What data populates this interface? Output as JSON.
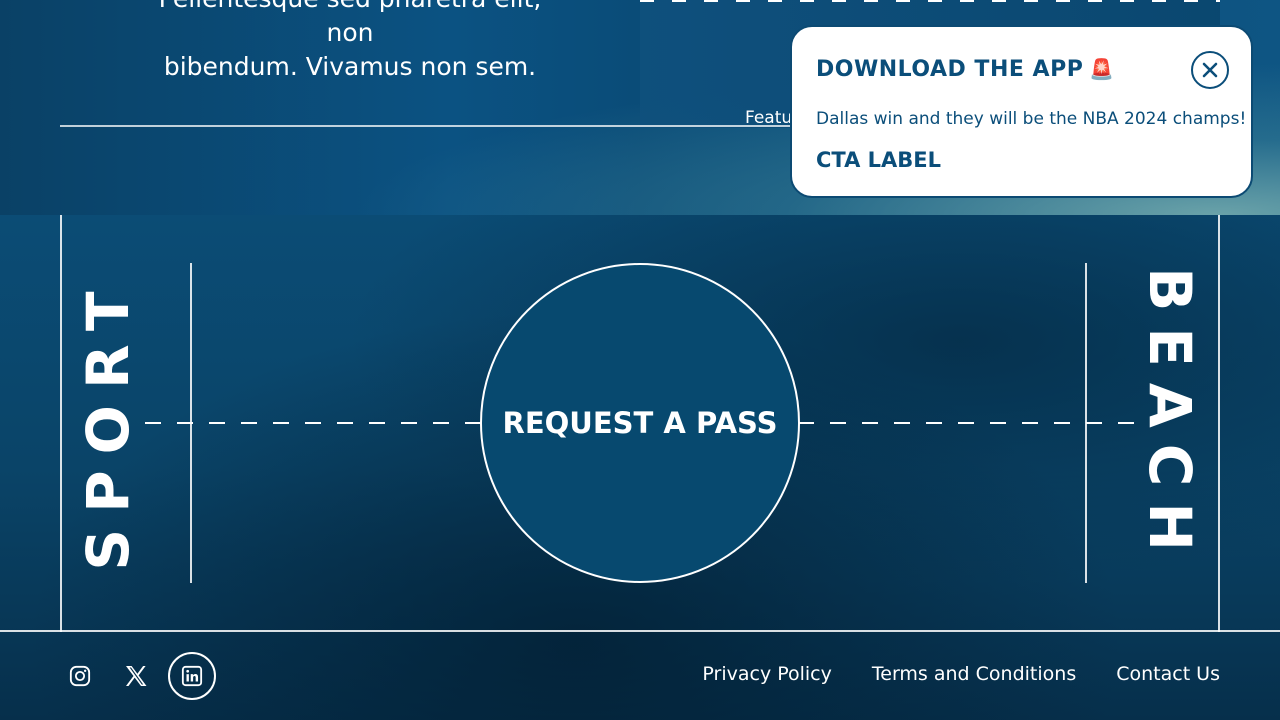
{
  "hero": {
    "quote_line1": "Pellentesque sed pharetra elit, non",
    "quote_line2": "bibendum. Vivamus non sem.",
    "feature_label": "Featu"
  },
  "court": {
    "left_word": "SPORT",
    "right_word": "BEACH",
    "cta_label": "REQUEST A PASS"
  },
  "footer": {
    "social": [
      {
        "name": "instagram-icon"
      },
      {
        "name": "x-icon"
      },
      {
        "name": "linkedin-icon"
      }
    ],
    "links": {
      "privacy": "Privacy Policy",
      "terms": "Terms and Conditions",
      "contact": "Contact Us"
    }
  },
  "toast": {
    "title": "DOWNLOAD THE APP",
    "alarm_icon": "🚨",
    "message": "Dallas win and they will be the NBA 2024 champs!",
    "cta_label": "CTA LABEL",
    "close_icon": "close-icon"
  },
  "colors": {
    "brand_blue": "#0b4e7a",
    "background": "#063452",
    "white": "#ffffff"
  }
}
